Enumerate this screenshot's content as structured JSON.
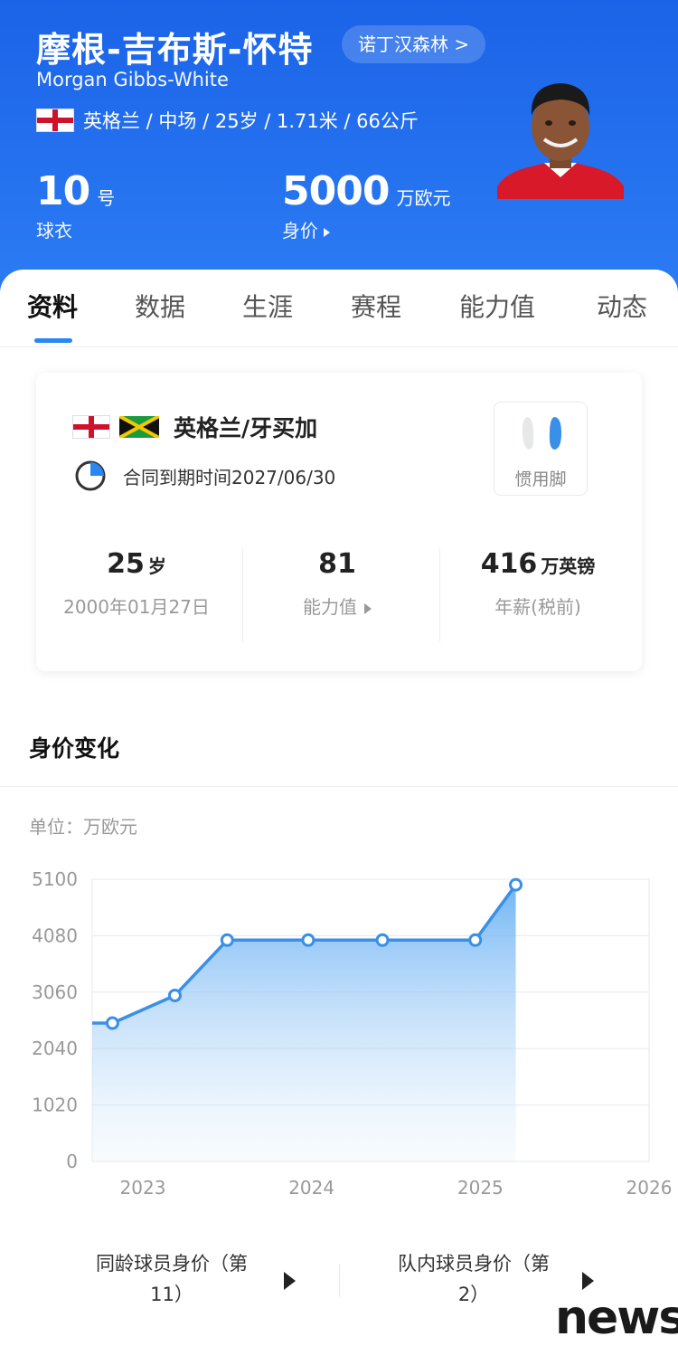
{
  "header": {
    "name_cn": "摩根-吉布斯-怀特",
    "club_chip": "诺丁汉森林 >",
    "name_en": "Morgan Gibbs-White",
    "meta": "英格兰 / 中场 / 25岁 / 1.71米 / 66公斤",
    "jersey_number": "10",
    "jersey_unit": "号",
    "jersey_label": "球衣",
    "market_value": "5000",
    "market_value_unit": "万欧元",
    "market_value_label": "身价"
  },
  "tabs": [
    {
      "label": "资料",
      "active": true
    },
    {
      "label": "数据",
      "active": false
    },
    {
      "label": "生涯",
      "active": false
    },
    {
      "label": "赛程",
      "active": false
    },
    {
      "label": "能力值",
      "active": false
    },
    {
      "label": "动态",
      "active": false
    }
  ],
  "card": {
    "nationality": "英格兰/牙买加",
    "contract": "合同到期时间2027/06/30",
    "preferred_foot_label": "惯用脚",
    "stats": [
      {
        "value": "25",
        "unit": "岁",
        "sub": "2000年01月27日"
      },
      {
        "value": "81",
        "unit": "",
        "sub": "能力值"
      },
      {
        "value": "416",
        "unit": "万英镑",
        "sub": "年薪(税前)"
      }
    ]
  },
  "section": {
    "title": "身价变化",
    "unit_label": "单位：万欧元"
  },
  "chart_data": {
    "type": "area",
    "y_ticks": [
      "5100",
      "4080",
      "3060",
      "2040",
      "1020",
      "0"
    ],
    "x_ticks": [
      "2023",
      "2024",
      "2025",
      "2026"
    ],
    "ylim": [
      0,
      5100
    ],
    "xlim": [
      2022.7,
      2026.0
    ],
    "grid": true,
    "x": [
      2022.82,
      2023.19,
      2023.5,
      2023.98,
      2024.42,
      2024.97,
      2025.21
    ],
    "values": [
      2500,
      3000,
      4000,
      4000,
      4000,
      4000,
      5000
    ],
    "line_color": "#3a8fe6"
  },
  "ranks": [
    {
      "line1": "同龄球员身价（第",
      "line2": "11）"
    },
    {
      "line1": "队内球员身价（第",
      "line2": "2）"
    }
  ],
  "watermark": "news",
  "colors": {
    "header_blue": "#1b63e8",
    "accent": "#2a86f2"
  }
}
